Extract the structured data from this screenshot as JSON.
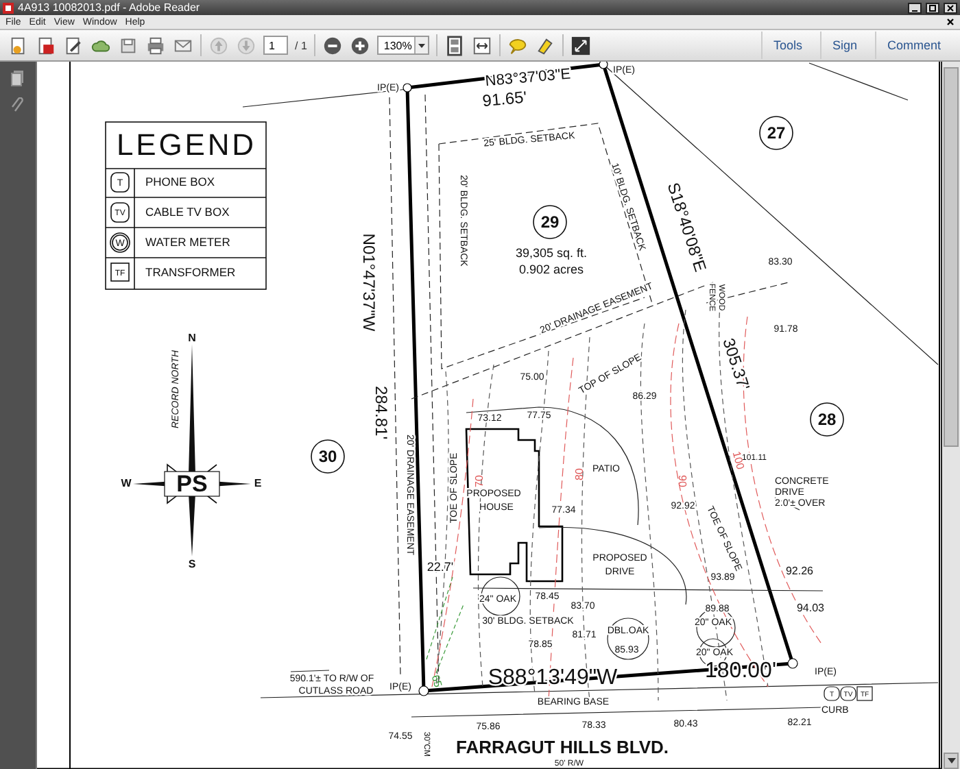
{
  "window": {
    "title": "4A913 10082013.pdf - Adobe Reader"
  },
  "menu": [
    "File",
    "Edit",
    "View",
    "Window",
    "Help"
  ],
  "toolbar": {
    "page": "1",
    "page_count": "/ 1",
    "zoom": "130%",
    "panes": [
      "Tools",
      "Sign",
      "Comment"
    ]
  },
  "legend": {
    "title": "LEGEND",
    "items": [
      {
        "symbol": "T",
        "kind": "rounded",
        "label": "PHONE BOX"
      },
      {
        "symbol": "TV",
        "kind": "rounded",
        "label": "CABLE TV BOX"
      },
      {
        "symbol": "W",
        "kind": "circle",
        "label": "WATER METER"
      },
      {
        "symbol": "TF",
        "kind": "square",
        "label": "TRANSFORMER"
      }
    ]
  },
  "lots": [
    "29",
    "27",
    "28",
    "30"
  ],
  "plat_labels": [
    "N83°37'03\"E",
    "91.65'",
    "IP(E)",
    "IP(E)",
    "25' BLDG. SETBACK",
    "20' BLDG. SETBACK",
    "10' BLDG. SETBACK",
    "39,305 sq. ft.",
    "0.902 acres",
    "S18°40'08\"E",
    "83.30",
    "WOOD",
    "FENCE",
    "91.78",
    "20' DRAINAGE EASEMENT",
    "305.37'",
    "N01°47'37\"W",
    "284.81'",
    "20' DRAINAGE EASEMENT",
    "RECORD NORTH",
    "75.00",
    "TOP OF SLOPE",
    "86.29",
    "73.12",
    "77.75",
    "PATIO",
    "PROPOSED",
    "HOUSE",
    "77.34",
    "TOE OF SLOPE",
    "22.7'",
    "PROPOSED",
    "DRIVE",
    "92.92",
    "TOE OF SLOPE",
    "93.89",
    "92.26",
    "89.88",
    "94.03",
    "101.11",
    "CONCRETE",
    "DRIVE",
    "2.0'± OVER",
    "24\" OAK",
    "78.45",
    "83.70",
    "30' BLDG. SETBACK",
    "81.71",
    "DBL.OAK",
    "85.93",
    "78.85",
    "20\" OAK",
    "20\" OAK",
    "S88°13'49\"W",
    "180.00'",
    "IP(E)",
    "IP(E)",
    "590.1'± TO R/W OF",
    "CUTLASS ROAD",
    "BEARING BASE",
    "74.55",
    "75.86",
    "78.33",
    "80.43",
    "CURB",
    "82.21",
    "30\"CM"
  ],
  "contour_labels": [
    {
      "text": "70",
      "color": "#e05a5a"
    },
    {
      "text": "80",
      "color": "#e05a5a"
    },
    {
      "text": "90",
      "color": "#e05a5a"
    },
    {
      "text": "100",
      "color": "#e05a5a"
    },
    {
      "text": "65",
      "color": "#3a9a3a"
    }
  ],
  "compass": {
    "north": "N",
    "south": "S",
    "east": "E",
    "west": "W",
    "logo": "PS"
  },
  "road": {
    "name": "FARRAGUT HILLS BLVD.",
    "width": "50' R/W"
  },
  "utility_marks": [
    "T",
    "TV",
    "TF"
  ]
}
